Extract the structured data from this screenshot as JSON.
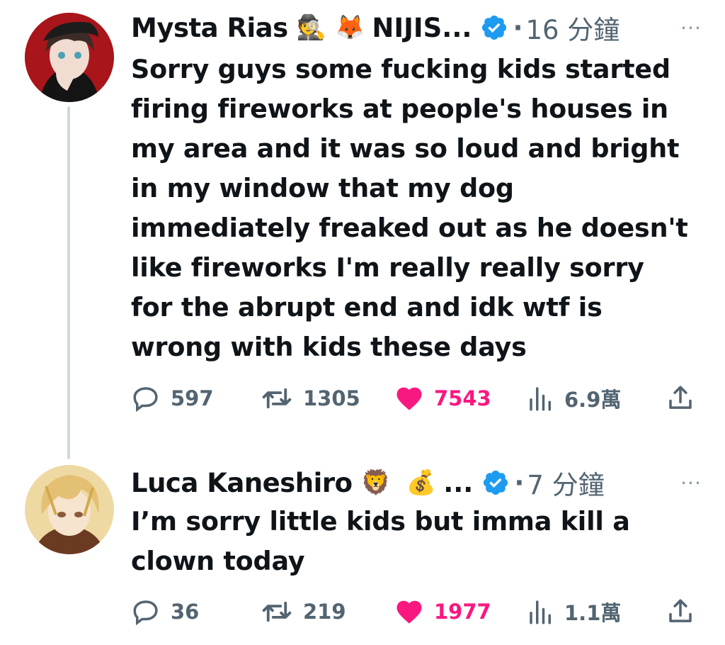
{
  "thread": {
    "tweets": [
      {
        "author_name": "Mysta Rias",
        "author_emoji_1": "🕵️",
        "author_emoji_2": "🦊",
        "author_name_suffix": "NIJIS...",
        "time": "16 分鐘",
        "body_lines": [
          "Sorry guys some fucking kids started",
          "firing fireworks at people's houses in",
          "my area and it was so loud and bright",
          "in my window that my dog",
          "immediately freaked out as he doesn't",
          "like fireworks I'm really really sorry",
          "for the abrupt end and idk wtf is",
          "wrong with kids these days"
        ],
        "replies": "597",
        "reposts": "1305",
        "likes": "7543",
        "views": "6.9萬"
      },
      {
        "author_name": "Luca Kaneshiro",
        "author_emoji_1": "🦁",
        "author_emoji_2": "💰",
        "author_name_suffix": "...",
        "time": "7 分鐘",
        "body_lines": [
          "I’m sorry little kids but imma kill a",
          "clown today"
        ],
        "replies": "36",
        "reposts": "219",
        "likes": "1977",
        "views": "1.1萬"
      }
    ]
  },
  "ui": {
    "dot_separator": "·",
    "more_glyph": "···"
  },
  "colors": {
    "text": "#0f1419",
    "muted": "#536471",
    "like": "#f91880",
    "verified": "#1d9bf0",
    "thread_line": "#cfd9de"
  },
  "icons": [
    "reply-icon",
    "repost-icon",
    "like-icon",
    "views-icon",
    "share-icon",
    "verified-badge-icon",
    "more-icon"
  ]
}
